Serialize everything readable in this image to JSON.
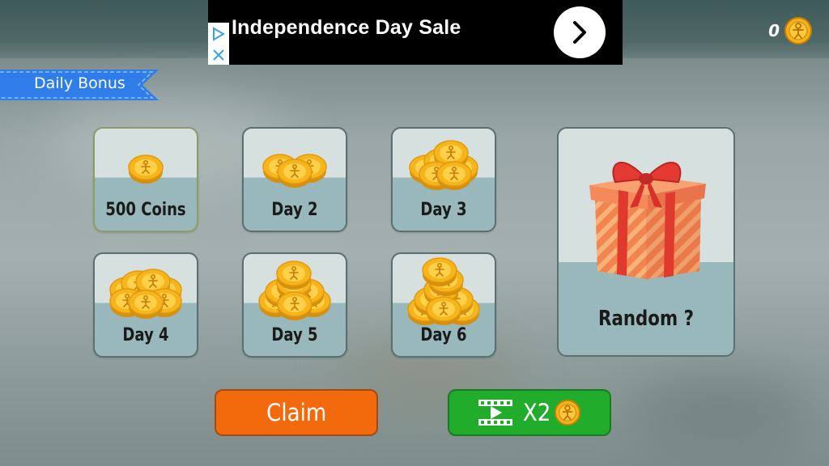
{
  "ad": {
    "title": "Independence Day Sale",
    "choices_icon": "ad-choices-icon",
    "close_icon": "close-icon",
    "action_icon": "chevron-right-icon"
  },
  "coin_counter": {
    "value": "0",
    "icon": "coin-icon"
  },
  "panel": {
    "title": "Daily Bonus"
  },
  "rewards": [
    {
      "label": "500 Coins",
      "selected": true
    },
    {
      "label": "Day 2",
      "selected": false
    },
    {
      "label": "Day 3",
      "selected": false
    },
    {
      "label": "Day 4",
      "selected": false
    },
    {
      "label": "Day 5",
      "selected": false
    },
    {
      "label": "Day 6",
      "selected": false
    }
  ],
  "random_reward": {
    "label": "Random ?",
    "icon": "gift-box-icon"
  },
  "buttons": {
    "claim_label": "Claim",
    "double_label": "X2",
    "double_icons": [
      "video-icon",
      "coin-icon"
    ]
  },
  "colors": {
    "claim": "#f36a0d",
    "double": "#21ad2b",
    "coin": "#f5b21a",
    "ribbon": "#2f7de8"
  }
}
